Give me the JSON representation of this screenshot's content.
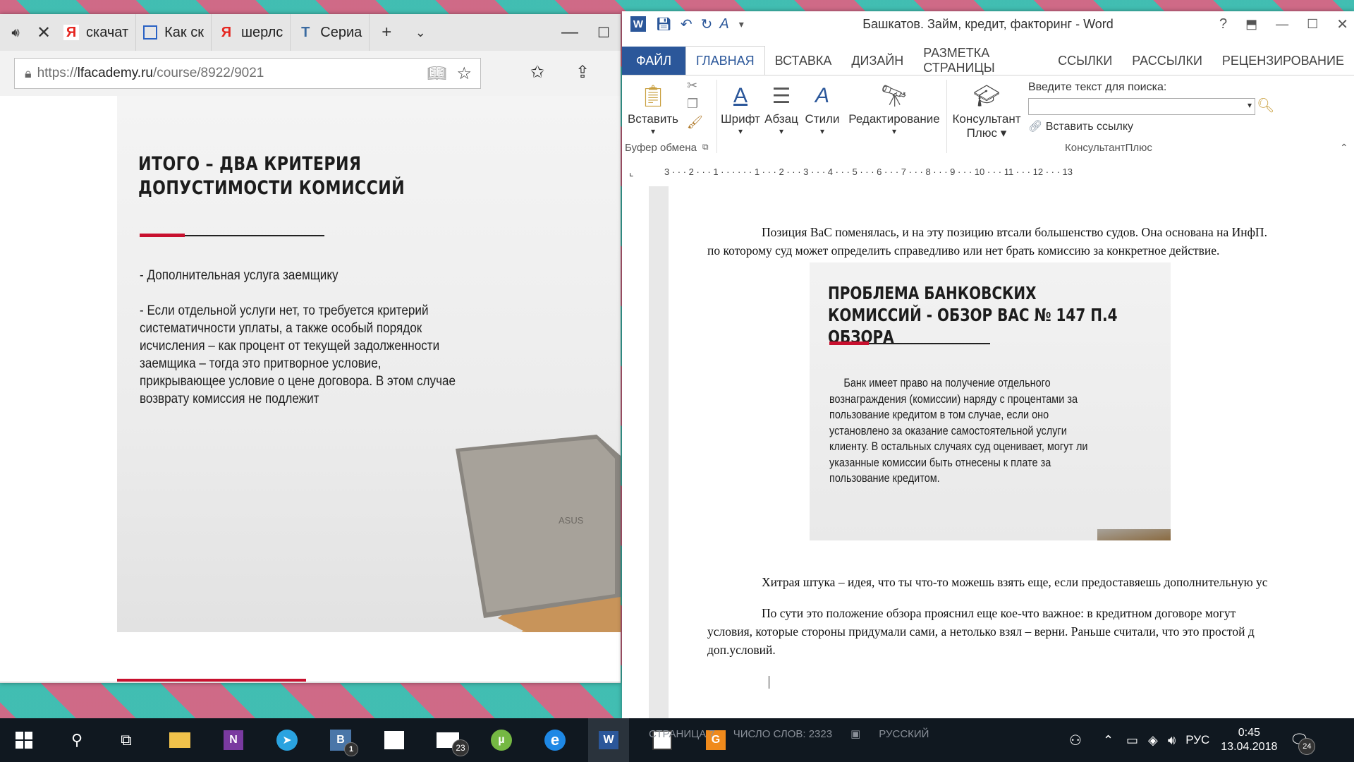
{
  "browser": {
    "tabs": [
      {
        "label": "скачат",
        "icon": "yandex-icon"
      },
      {
        "label": "Как ск",
        "icon": "page-icon"
      },
      {
        "label": "шерлс",
        "icon": "yandex-icon"
      },
      {
        "label": "Сериа",
        "icon": "t-icon"
      }
    ],
    "address": {
      "prefix": "https://",
      "domain": "lfacademy.ru",
      "path": "/course/8922/9021"
    },
    "slide": {
      "title": "ИТОГО – ДВА КРИТЕРИЯ ДОПУСТИМОСТИ КОМИССИЙ",
      "item1": "- Дополнительная услуга заемщику",
      "item2": "- Если отдельной услуги нет, то требуется критерий систематичности уплаты, а также особый порядок исчисления – как процент от текущей задолженности заемщика – тогда это притворное условие, прикрывающее условие о цене договора. В этом случае возврату комиссия не подлежит",
      "laptop_brand": "ASUS"
    }
  },
  "word": {
    "title": "Башкатов. Займ, кредит, факторинг - Word",
    "help": "?",
    "menu": [
      "ФАЙЛ",
      "ГЛАВНАЯ",
      "ВСТАВКА",
      "ДИЗАЙН",
      "РАЗМЕТКА СТРАНИЦЫ",
      "ССЫЛКИ",
      "РАССЫЛКИ",
      "РЕЦЕНЗИРОВАНИЕ"
    ],
    "ribbon": {
      "paste": "Вставить",
      "clipboard_group": "Буфер обмена",
      "font": "Шрифт",
      "paragraph": "Абзац",
      "styles": "Стили",
      "editing": "Редактирование",
      "consultant_line1": "Консультант",
      "consultant_line2": "Плюс",
      "search_label": "Введите текст для поиска:",
      "insert_link": "Вставить ссылку",
      "consultant_group": "КонсультантПлюс"
    },
    "ruler_numbers": "3 · · · 2 · · · 1 · · · · · · 1 · · · 2 · · · 3 · · · 4 · · · 5 · · · 6 · · · 7 · · · 8 · · · 9 · · · 10 · · · 11 · · · 12 · · · 13",
    "doc": {
      "p1_line1": "Позиция ВаС поменялась, и на эту позицию втсали большенство судов. Она основана на  ИнфП. ",
      "p1_line2": "по которому суд может определить справедливо или нет брать комиссию за конкретное действие.",
      "embed_title": "ПРОБЛЕМА БАНКОВСКИХ КОМИССИЙ - ОБЗОР ВАС № 147 П.4 ОБЗОРА",
      "embed_body": "Банк имеет право на получение отдельного вознаграждения (комиссии) наряду с процентами за пользование кредитом в том случае, если оно установлено за оказание самостоятельной услуги клиенту. В остальных случаях суд оценивает, могут ли указанные комиссии быть отнесены к плате за пользование кредитом.",
      "p2": "Хитрая штука – идея, что ты что-то можешь взять еще, если предоставяешь дополнительную ус",
      "p3_line1": "По сути это положение обзора прояснил еще кое-что важное: в кредитном договоре могут",
      "p3_line2": "условия, которые стороны придумали сами, а нетолько взял – верни. Раньше считали, что это простой д",
      "p3_line3": "доп.условий."
    },
    "status": {
      "page": "СТРАНИЦА 7",
      "words": "ЧИСЛО СЛОВ: 2323",
      "lang": "РУССКИЙ"
    }
  },
  "taskbar": {
    "badges": {
      "vk": "1",
      "mail": "23"
    },
    "tray_lang": "РУС",
    "time": "0:45",
    "date": "13.04.2018",
    "notifications": "24"
  }
}
